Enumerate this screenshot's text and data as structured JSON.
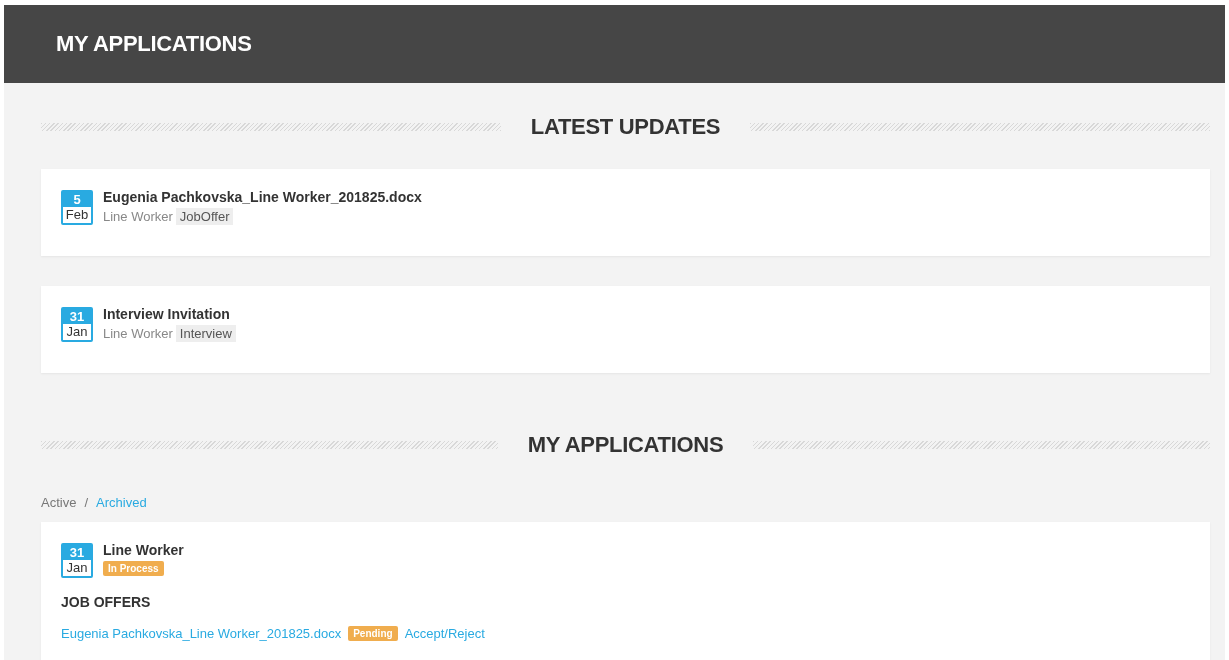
{
  "header": {
    "title": "MY APPLICATIONS"
  },
  "latest_updates": {
    "heading": "LATEST UPDATES",
    "items": [
      {
        "day": "5",
        "month": "Feb",
        "title": "Eugenia Pachkovska_Line Worker_201825.docx",
        "job": "Line Worker",
        "tag": "JobOffer"
      },
      {
        "day": "31",
        "month": "Jan",
        "title": "Interview Invitation",
        "job": "Line Worker",
        "tag": "Interview"
      }
    ]
  },
  "applications": {
    "heading": "MY APPLICATIONS",
    "filters": [
      {
        "label": "Active",
        "selected": true
      },
      {
        "label": "Archived",
        "selected": false
      }
    ],
    "separator": "/",
    "items": [
      {
        "day": "31",
        "month": "Jan",
        "title": "Line Worker",
        "status": "In Process",
        "offers_heading": "JOB OFFERS",
        "offers": [
          {
            "file": "Eugenia Pachkovska_Line Worker_201825.docx",
            "status": "Pending",
            "action": "Accept/Reject"
          }
        ]
      }
    ]
  }
}
